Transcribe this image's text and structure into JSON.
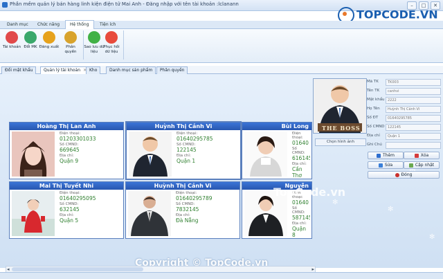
{
  "window": {
    "title": "Phần mềm quản lý bán hàng linh kiện điện tử Mai Anh - Đăng nhập với tên tài khoản :lclanann",
    "brand": "TOPCODE.VN"
  },
  "menu_tabs": [
    "Danh mục",
    "Chức năng",
    "Hệ thống",
    "Tiện ích"
  ],
  "ribbon": {
    "buttons": [
      {
        "label": "Tài khoản",
        "color": "#e14a4a"
      },
      {
        "label": "Đổi MK",
        "color": "#3aa86b"
      },
      {
        "label": "Đăng xuất",
        "color": "#e6a21c"
      },
      {
        "label": "Phân quyền",
        "color": "#d8a32c"
      },
      {
        "label": "Sao lưu dữ liệu",
        "color": "#41b145"
      },
      {
        "label": "Phục hồi dữ liệu",
        "color": "#e84b3c"
      }
    ]
  },
  "page_tabs": [
    "Đổi mật khẩu",
    "Quản lý tài khoản",
    "Kho",
    "Danh mục sản phẩm",
    "Phân quyền"
  ],
  "cards": [
    {
      "name": "Hoàng Thị Lan Anh",
      "phone_label": "Điện thoại:",
      "phone": "01203301033",
      "cmnd_label": "Số CMND:",
      "cmnd": "669645",
      "addr_label": "Địa chỉ:",
      "addr": "Quận 9"
    },
    {
      "name": "Huỳnh Thị Cảnh Vi",
      "phone_label": "Điện thoại:",
      "phone": "01640295785",
      "cmnd_label": "Số CMND:",
      "cmnd": "122145",
      "addr_label": "Địa chỉ:",
      "addr": "Quận 1"
    },
    {
      "name": "Bùi Long",
      "phone_label": "Điện thoại:",
      "phone": "01640",
      "cmnd_label": "Số CMND:",
      "cmnd": "616145",
      "addr_label": "Địa chỉ:",
      "addr": "Cần Thơ"
    },
    {
      "name": "Mai Thị Tuyết Nhi",
      "phone_label": "Điện thoại:",
      "phone": "01640295095",
      "cmnd_label": "Số CMND:",
      "cmnd": "632145",
      "addr_label": "Địa chỉ:",
      "addr": "Quận 5"
    },
    {
      "name": "Huỳnh Thị Cảnh Vi",
      "phone_label": "Điện thoại:",
      "phone": "01640295789",
      "cmnd_label": "Số CMND:",
      "cmnd": "7832145",
      "addr_label": "Địa chỉ:",
      "addr": "Đà Nẵng"
    },
    {
      "name": "Nguyễn",
      "phone_label": "Điện thoại:",
      "phone": "01640",
      "cmnd_label": "Số CMND:",
      "cmnd": "587145",
      "addr_label": "Địa chỉ:",
      "addr": "Quận 8"
    }
  ],
  "detail": {
    "photo_caption": "THE BOSS",
    "choose_image": "Chọn hình ảnh",
    "fields": [
      {
        "label": "Mã TK",
        "value": "TK003"
      },
      {
        "label": "Tên TK",
        "value": "canhvi"
      },
      {
        "label": "Mật khẩu",
        "value": "2222"
      },
      {
        "label": "Họ Tên",
        "value": "Huỳnh Thị Cảnh Vi"
      },
      {
        "label": "Số ĐT",
        "value": "01640295785"
      },
      {
        "label": "Số CMND",
        "value": "122145"
      },
      {
        "label": "Địa chỉ",
        "value": "Quận 1"
      },
      {
        "label": "Ghi Chú",
        "value": ""
      }
    ],
    "buttons": {
      "add": "Thêm",
      "delete": "Xóa",
      "edit": "Sửa",
      "update": "Cập nhật",
      "close": "Đóng"
    }
  },
  "watermark": {
    "center": "TopCode.vn",
    "bottom": "Copyright © TopCode.vn"
  }
}
